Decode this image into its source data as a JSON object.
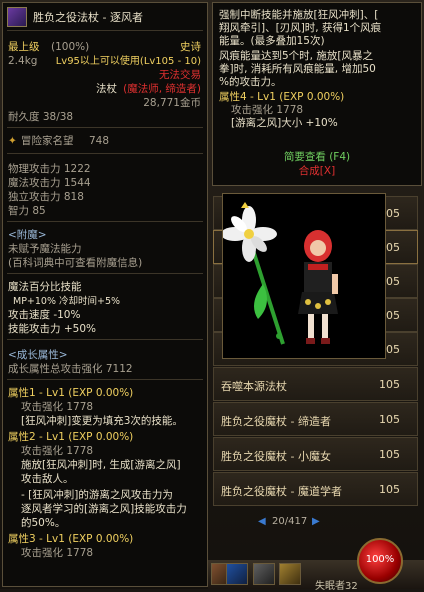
{
  "tooltip": {
    "title": "胜负之役法杖 - 逐风者",
    "rarity_label": "最上级",
    "rarity_pct": "(100%)",
    "grade": "史诗",
    "weight": "2.4kg",
    "level_req": "Lv95以上可以使用(Lv105 - 10)",
    "trade": "无法交易",
    "type": "法杖",
    "class": "(魔法师, 缔造者)",
    "price": "28,771金币",
    "durability": "耐久度 38/38",
    "adventure": "冒险家名望",
    "adventure_val": "748",
    "stats": [
      "物理攻击力 1222",
      "魔法攻击力 1544",
      "独立攻击力 818",
      "智力 85"
    ],
    "enchant_header": "<附魔>",
    "enchant_1": "未赋予魔法能力",
    "enchant_2": "(百科词典中可查看附魔信息)",
    "magic_1": "魔法百分比技能",
    "magic_2": "MP+10% 冷却时间+5%",
    "magic_3": "攻击速度 -10%",
    "magic_4": "技能攻击力 +50%",
    "growth_header": "<成长属性>",
    "growth_total": "成长属性总攻击强化 7112",
    "attr1": "属性1 - Lv1 (EXP 0.00%)",
    "attr1_sub": "攻击强化 1778",
    "attr1_desc": "[狂风冲刺]变更为填充3次的技能。",
    "attr2": "属性2 - Lv1 (EXP 0.00%)",
    "attr2_sub": "攻击强化 1778",
    "attr2_desc1": "施放[狂风冲刺]时, 生成[游离之风]",
    "attr2_desc2": "攻击敌人。",
    "attr2_desc3": "- [狂风冲刺]的游离之风攻击力为",
    "attr2_desc4": "逐风者学习的[游离之风]技能攻击力",
    "attr2_desc5": "的50%。",
    "attr3": "属性3 - Lv1 (EXP 0.00%)",
    "attr3_sub": "攻击强化 1778"
  },
  "tooltip2": {
    "l1": "强制中断技能并施放[狂风冲刺]、[",
    "l2": "翔风牵引]、[刃风]时, 获得1个风痕",
    "l3": "能量。(最多叠加15次)",
    "l4": "风痕能量达到5个时, 施放[风暴之",
    "l5": "拳]时, 消耗所有风痕能量, 增加50",
    "l6": "%的攻击力。",
    "attr4": "属性4 - Lv1 (EXP 0.00%)",
    "attr4_sub": "攻击强化 1778",
    "attr4_desc": "[游离之风]大小 +10%",
    "brief": "简要查看 (F4)",
    "compose": "合成[X]"
  },
  "list": {
    "items": [
      {
        "name": "",
        "level": "105"
      },
      {
        "name": "",
        "level": "105"
      },
      {
        "name": "",
        "level": "105"
      },
      {
        "name": "",
        "level": "105"
      },
      {
        "name": "",
        "level": "105"
      },
      {
        "name": "吞噬本源法杖",
        "level": "105"
      },
      {
        "name": "胜负之役魔杖 - 缔造者",
        "level": "105"
      },
      {
        "name": "胜负之役魔杖 - 小魔女",
        "level": "105"
      },
      {
        "name": "胜负之役魔杖 - 魔道学者",
        "level": "105"
      }
    ],
    "page": "20/417"
  },
  "hud": {
    "hp": "100%",
    "char_name": "失眠者32"
  },
  "colors": {
    "border": "#5a4f3a",
    "yellow": "#f0d060",
    "green": "#70d060",
    "red": "#e03030",
    "page_arrow": "#3a7ad0"
  }
}
